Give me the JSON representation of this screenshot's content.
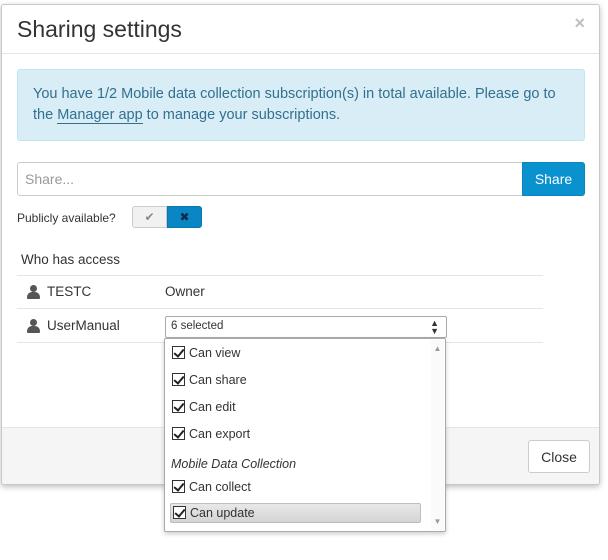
{
  "dialog": {
    "title": "Sharing settings",
    "close_glyph": "×"
  },
  "alert": {
    "text_before": "You have 1/2 Mobile data collection subscription(s) in total available. Please go to the ",
    "link": "Manager app",
    "text_after": " to manage your subscriptions."
  },
  "share": {
    "placeholder": "Share...",
    "button_label": "Share"
  },
  "public": {
    "label": "Publicly available?",
    "yes_icon": "check-icon",
    "no_icon": "cross-icon",
    "yes_glyph": "✔",
    "no_glyph": "✖",
    "selected": "no"
  },
  "access": {
    "heading": "Who has access",
    "users": [
      {
        "name": "TESTC",
        "role": "Owner"
      },
      {
        "name": "UserManual",
        "selection": "6 selected"
      }
    ]
  },
  "dropdown": {
    "items": [
      {
        "label": "Can view",
        "checked": true
      },
      {
        "label": "Can share",
        "checked": true
      },
      {
        "label": "Can edit",
        "checked": true
      },
      {
        "label": "Can export",
        "checked": true
      }
    ],
    "group_label": "Mobile Data Collection",
    "group_items": [
      {
        "label": "Can collect",
        "checked": true
      },
      {
        "label": "Can update",
        "checked": true
      }
    ],
    "caret_up": "▲",
    "caret_down": "▼"
  },
  "footer": {
    "close_label": "Close"
  },
  "colors": {
    "primary": "#0a92cf",
    "alert_bg": "#d9edf7",
    "alert_text": "#31708f"
  }
}
